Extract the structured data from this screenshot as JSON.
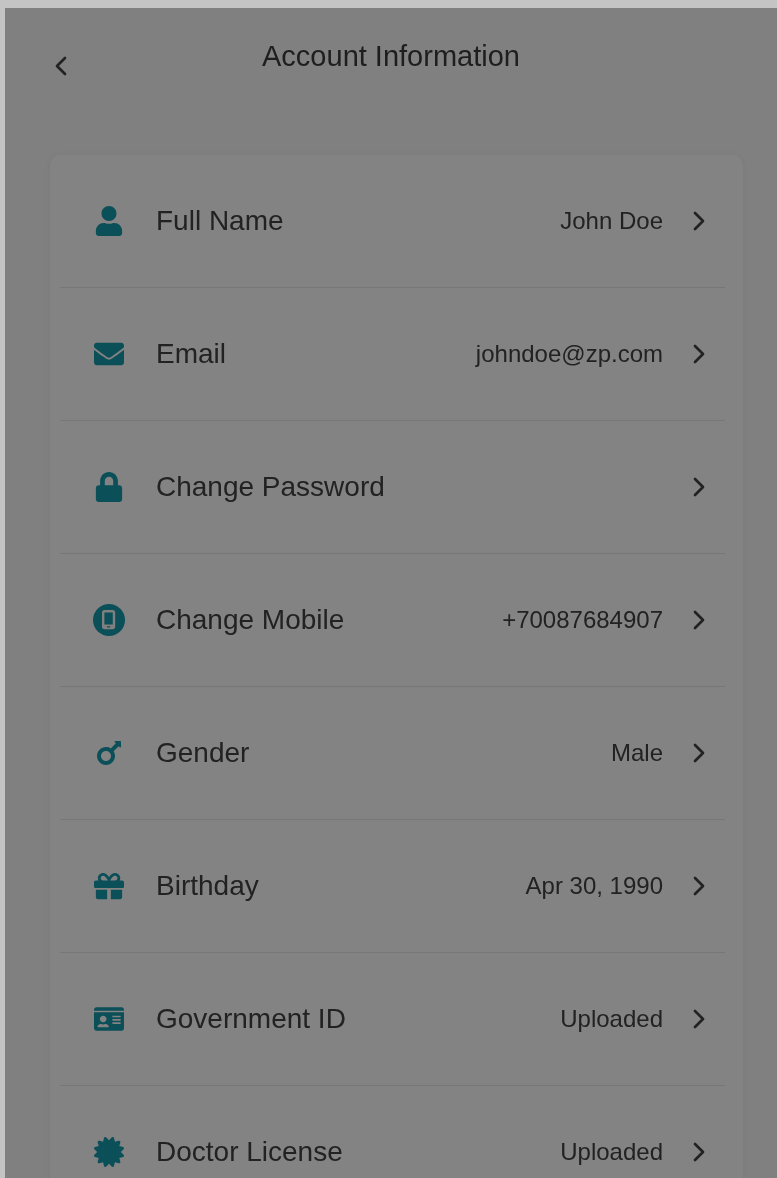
{
  "header": {
    "title": "Account Information"
  },
  "rows": [
    {
      "label": "Full Name",
      "value": "John Doe"
    },
    {
      "label": "Email",
      "value": "johndoe@zp.com"
    },
    {
      "label": "Change Password"
    },
    {
      "label": "Change Mobile",
      "value": "+70087684907"
    },
    {
      "label": "Gender",
      "value": "Male"
    },
    {
      "label": "Birthday",
      "value": "Apr 30, 1990"
    },
    {
      "label": "Government ID",
      "value": "Uploaded"
    },
    {
      "label": "Doctor License",
      "value": "Uploaded"
    }
  ]
}
